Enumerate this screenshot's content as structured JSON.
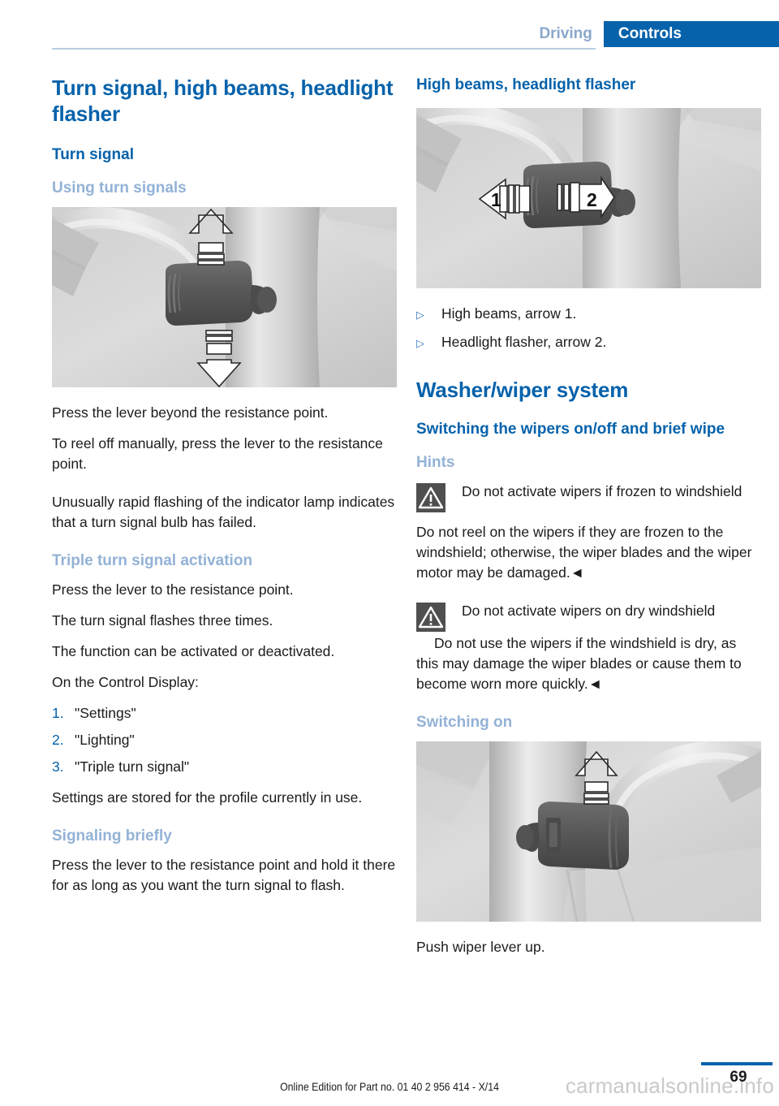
{
  "header": {
    "inactive_tab": "Driving",
    "active_tab": "Controls",
    "accent_color": "#0562ab",
    "inactive_color": "#8ba7cc"
  },
  "left_column": {
    "chapter_title": "Turn signal, high beams, headlight flasher",
    "section_title": "Turn signal",
    "subsection_1": "Using turn signals",
    "figure_1_alt": "turn-signal-lever-up-down-arrows",
    "paragraphs_1": [
      "Press the lever beyond the resistance point.",
      "To reel off manually, press the lever to the resistance point.",
      "Unusually rapid flashing of the indicator lamp indicates that a turn signal bulb has failed."
    ],
    "subsection_2": "Triple turn signal activation",
    "paragraphs_2": [
      "Press the lever to the resistance point.",
      "The turn signal flashes three times.",
      "The function can be activated or deactivated.",
      "On the Control Display:"
    ],
    "numbered_list": [
      {
        "num": "1.",
        "text": "\"Settings\""
      },
      {
        "num": "2.",
        "text": "\"Lighting\""
      },
      {
        "num": "3.",
        "text": "\"Triple turn signal\""
      }
    ],
    "paragraph_after_list": "Settings are stored for the profile currently in use.",
    "subsection_3": "Signaling briefly",
    "paragraph_3": "Press the lever to the resistance point and hold it there for as long as you want the turn signal to flash."
  },
  "right_column": {
    "section_title": "High beams, headlight flasher",
    "figure_2_alt": "high-beam-lever-arrows-1-and-2",
    "figure_2_label_1": "1",
    "figure_2_label_2": "2",
    "bullets": [
      {
        "marker": "▷",
        "text": "High beams, arrow 1."
      },
      {
        "marker": "▷",
        "text": "Headlight flasher, arrow 2."
      }
    ],
    "chapter_title": "Washer/wiper system",
    "section_title_2": "Switching the wipers on/off and brief wipe",
    "subsection_hints": "Hints",
    "warning_1": {
      "icon": "warning-triangle-icon",
      "heading": "Do not activate wipers if frozen to windshield",
      "body": "Do not reel on the wipers if they are frozen to the windshield; otherwise, the wiper blades and the wiper motor may be damaged.◄"
    },
    "warning_2": {
      "icon": "warning-triangle-icon",
      "heading": "Do not activate wipers on dry windshield",
      "body": "Do not use the wipers if the windshield is dry, as this may damage the wiper blades or cause them to become worn more quickly.◄"
    },
    "subsection_switching_on": "Switching on",
    "figure_3_alt": "wiper-lever-up-arrow",
    "caption_3": "Push wiper lever up."
  },
  "footer": {
    "edition": "Online Edition for Part no. 01 40 2 956 414 - X/14",
    "page_number": "69",
    "watermark": "carmanualsonline.info"
  }
}
